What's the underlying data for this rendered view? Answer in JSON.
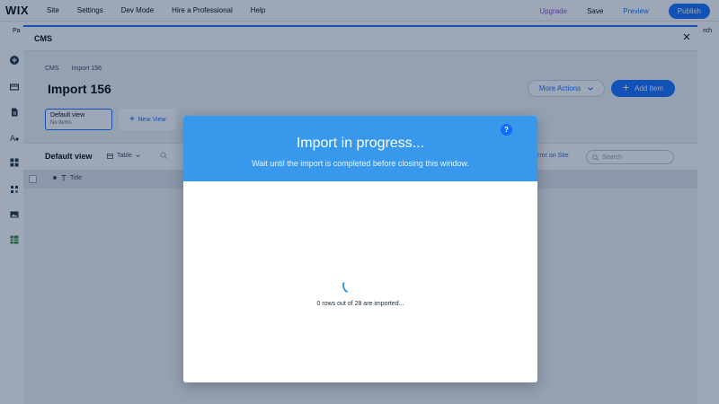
{
  "editor": {
    "logo": "WIX",
    "menu": [
      "Site",
      "Settings",
      "Dev Mode",
      "Hire a Professional",
      "Help"
    ],
    "upgrade": "Upgrade",
    "save": "Save",
    "preview": "Preview",
    "publish": "Publish",
    "left_cut_label": "Pa",
    "right_cut_label": "rch"
  },
  "cms": {
    "title": "CMS",
    "close_icon": "close-icon",
    "breadcrumb": [
      "CMS",
      "Import 156"
    ],
    "page_title": "Import 156",
    "more_actions": "More Actions",
    "add_item": "Add Item",
    "view_card": {
      "name": "Default view",
      "count": "No items"
    },
    "new_view": "New View",
    "toolbar": {
      "view_name": "Default view",
      "table_label": "Table",
      "error_on_site": "rror on Site",
      "search_placeholder": "Search"
    },
    "column_title": "Title"
  },
  "import_modal": {
    "title": "Import in progress...",
    "subtitle": "Wait until the import is completed before closing this window.",
    "help_label": "?",
    "progress_text": "0 rows out of 28 are imported..."
  },
  "colors": {
    "accent": "#116dff",
    "modal_header": "#3899ec",
    "upgrade": "#8b3dff"
  }
}
